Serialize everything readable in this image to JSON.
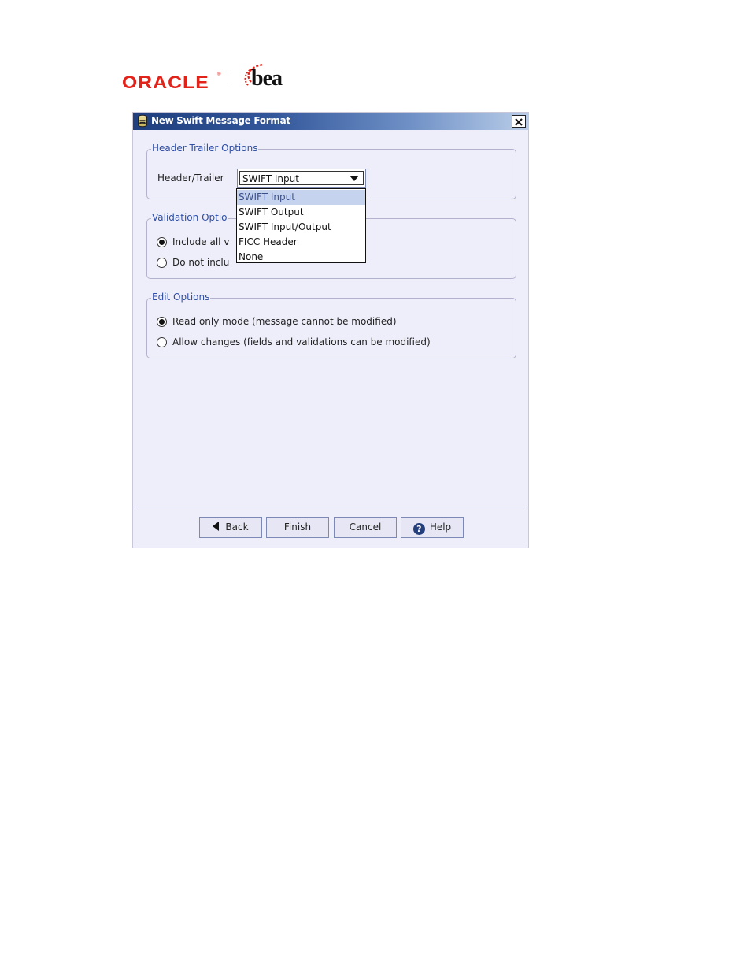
{
  "logo": {
    "oracle": "ORACLE",
    "bea": "bea",
    "oracle_mark": "®"
  },
  "dialog": {
    "title": "New Swift Message Format",
    "title_icon": "app-icon",
    "close_icon": "close-icon"
  },
  "header_trailer": {
    "legend": "Header Trailer Options",
    "label": "Header/Trailer",
    "selected": "SWIFT Input",
    "options": [
      "SWIFT Input",
      "SWIFT Output",
      "SWIFT Input/Output",
      "FICC Header",
      "None"
    ]
  },
  "validation": {
    "legend": "Validation Optio",
    "option1": "Include all v",
    "option2": "Do not inclu"
  },
  "edit": {
    "legend": "Edit Options",
    "option1": "Read only mode (message cannot be modified)",
    "option2": "Allow changes (fields and validations can be modified)"
  },
  "buttons": {
    "back": "Back",
    "finish": "Finish",
    "cancel": "Cancel",
    "help": "Help",
    "help_glyph": "?"
  },
  "colors": {
    "title_start": "#1f3f7d",
    "title_end": "#b9cde8",
    "legend": "#2e4fa5",
    "oracle_red": "#e2231a",
    "dialog_bg": "#eeeefa",
    "selected_row": "#c5d3ee"
  }
}
